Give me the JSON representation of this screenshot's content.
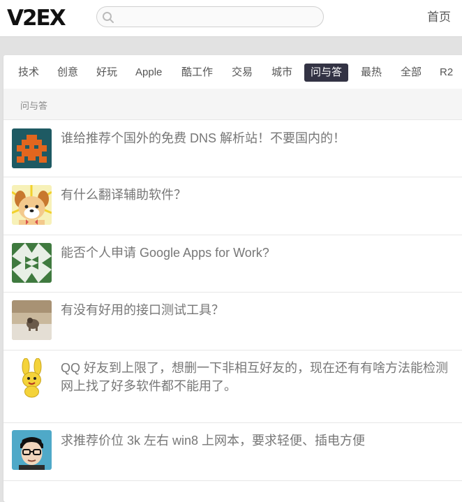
{
  "header": {
    "logo": "V2EX",
    "search_placeholder": "",
    "home_link": "首页"
  },
  "tabs": [
    "技术",
    "创意",
    "好玩",
    "Apple",
    "酷工作",
    "交易",
    "城市",
    "问与答",
    "最热",
    "全部",
    "R2"
  ],
  "current_tab": "问与答",
  "node_title": "问与答",
  "topics": [
    {
      "title": "谁给推荐个国外的免费 DNS 解析站！不要国内的！",
      "avatar": "pixel-invader-avatar"
    },
    {
      "title": "有什么翻译辅助软件？",
      "avatar": "cartoon-dog-avatar"
    },
    {
      "title": "能否个人申请 Google Apps for Work?",
      "avatar": "geometric-pattern-avatar"
    },
    {
      "title": "有没有好用的接口测试工具？",
      "avatar": "dog-photo-avatar"
    },
    {
      "title": "QQ 好友到上限了，想删一下非相互好友的，现在还有有啥方法能检测\n网上找了好多软件都不能用了。",
      "avatar": "yellow-bunny-avatar"
    },
    {
      "title": "求推荐价位 3k 左右 win8 上网本，要求轻便、插电方便",
      "avatar": "glasses-man-avatar"
    }
  ],
  "colors": {
    "current_tab_bg": "#334",
    "avatar1_bg": "#1e5a63",
    "avatar1_fg": "#e2661e",
    "avatar3_bg": "#3f7a3f"
  }
}
